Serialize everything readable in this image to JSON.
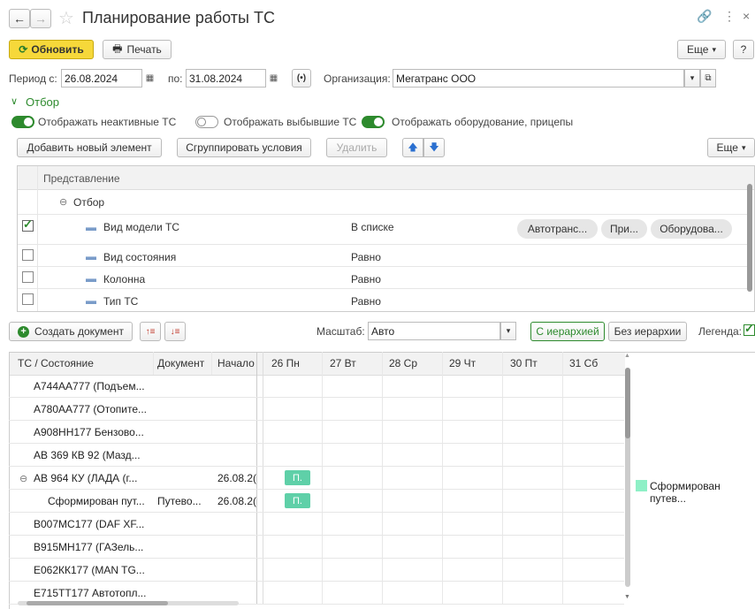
{
  "window": {
    "title": "Планирование работы ТС"
  },
  "toolbar": {
    "refresh_label": "Обновить",
    "print_label": "Печать",
    "more_label": "Еще",
    "help_label": "?"
  },
  "period": {
    "from_label": "Период с:",
    "from_value": "26.08.2024",
    "to_label": "по:",
    "to_value": "31.08.2024",
    "org_label": "Организация:",
    "org_value": "Мегатранс ООО"
  },
  "filter": {
    "title": "Отбор",
    "toggles": [
      {
        "label": "Отображать неактивные ТС",
        "on": true
      },
      {
        "label": "Отображать выбывшие ТС",
        "on": false
      },
      {
        "label": "Отображать оборудование, прицепы",
        "on": true
      }
    ],
    "add_label": "Добавить новый элемент",
    "group_label": "Сгруппировать условия",
    "delete_label": "Удалить",
    "more_label": "Еще",
    "column_header": "Представление",
    "group_node": "Отбор",
    "rows": [
      {
        "name": "Вид модели ТС",
        "condition": "В списке",
        "checked": true,
        "values": [
          "Автотранс...",
          "При...",
          "Оборудова..."
        ]
      },
      {
        "name": "Вид состояния",
        "condition": "Равно",
        "checked": false,
        "values": []
      },
      {
        "name": "Колонна",
        "condition": "Равно",
        "checked": false,
        "values": []
      },
      {
        "name": "Тип ТС",
        "condition": "Равно",
        "checked": false,
        "values": []
      }
    ]
  },
  "gantt_toolbar": {
    "create_label": "Создать документ",
    "scale_label": "Масштаб:",
    "scale_value": "Авто",
    "hier_label": "С иерархией",
    "nohier_label": "Без иерархии",
    "legend_label": "Легенда:"
  },
  "gantt": {
    "columns": [
      "ТС / Состояние",
      "Документ",
      "Начало"
    ],
    "days": [
      "26 Пн",
      "27 Вт",
      "28 Ср",
      "29 Чт",
      "30 Пт",
      "31 Сб"
    ],
    "rows": [
      {
        "name": "А744АА777 (Подъем...",
        "doc": "",
        "start": "",
        "bar": ""
      },
      {
        "name": "А780АА777 (Отопите...",
        "doc": "",
        "start": "",
        "bar": ""
      },
      {
        "name": "А908НН177 Бензово...",
        "doc": "",
        "start": "",
        "bar": ""
      },
      {
        "name": "АВ 369 КВ 92 (Мазд...",
        "doc": "",
        "start": "",
        "bar": ""
      },
      {
        "name": "АВ 964 КУ (ЛАДА (г...",
        "doc": "",
        "start": "26.08.2(",
        "bar": "П."
      },
      {
        "name": "Сформирован пут...",
        "doc": "Путево...",
        "start": "26.08.2(",
        "bar": "П."
      },
      {
        "name": "В007МС177 (DAF XF...",
        "doc": "",
        "start": "",
        "bar": ""
      },
      {
        "name": "В915МН177 (ГАЗель...",
        "doc": "",
        "start": "",
        "bar": ""
      },
      {
        "name": "Е062КК177 (MAN TG...",
        "doc": "",
        "start": "",
        "bar": ""
      },
      {
        "name": "Е715ТТ177 Автотопл...",
        "doc": "",
        "start": "",
        "bar": ""
      }
    ],
    "legend": [
      {
        "label": "Сформирован путев...",
        "color": "#8ef0c6"
      }
    ]
  }
}
